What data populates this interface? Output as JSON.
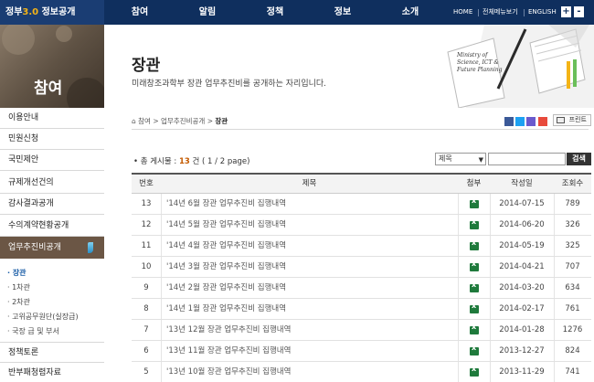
{
  "brand": {
    "prefix": "정부",
    "version": "3.0",
    "suffix": " 정보공개"
  },
  "nav": {
    "items": [
      "참여",
      "알림",
      "정책",
      "정보",
      "소개"
    ]
  },
  "util": {
    "home": "HOME",
    "sitemap": "전체메뉴보기",
    "english": "ENGLISH",
    "zoom_in": "+",
    "zoom_out": "-"
  },
  "sidebar": {
    "hero_title": "참여",
    "items": [
      "이용안내",
      "민원신청",
      "국민제안",
      "규제개선건의",
      "감사결과공개",
      "수의계약현황공개"
    ],
    "active": "업무추진비공개",
    "sub_items": [
      "· 장관",
      "· 1차관",
      "· 2차관",
      "· 고위공무원단(실장급)",
      "· 국장 급 및 부서"
    ],
    "after_items": [
      "정책토론",
      "반부패청렴자료"
    ]
  },
  "header": {
    "title": "장관",
    "desc": "미래창조과학부 장관 업무추진비를 공개하는 자리입니다.",
    "deco_text": "Ministry of Science, ICT & Future Planning"
  },
  "breadcrumb": {
    "home_icon": "home-icon",
    "part1": "참여",
    "part2": "업무추진비공개",
    "current": "장관"
  },
  "toolbar": {
    "print_label": "프린트"
  },
  "list": {
    "count_prefix": "• 총 게시물 : ",
    "count": "13",
    "count_suffix": " 건 ( 1 / 2 page)",
    "select_value": "제목",
    "search_button": "검색"
  },
  "table": {
    "headers": [
      "번호",
      "제목",
      "첨부",
      "작성일",
      "조회수"
    ],
    "rows": [
      {
        "no": "13",
        "title": "'14년 6월 장관 업무추진비 집행내역",
        "date": "2014-07-15",
        "views": "789"
      },
      {
        "no": "12",
        "title": "'14년 5월 장관 업무추진비 집행내역",
        "date": "2014-06-20",
        "views": "326"
      },
      {
        "no": "11",
        "title": "'14년 4월 장관 업무추진비 집행내역",
        "date": "2014-05-19",
        "views": "325"
      },
      {
        "no": "10",
        "title": "'14년 3월 장관 업무추진비 집행내역",
        "date": "2014-04-21",
        "views": "707"
      },
      {
        "no": "9",
        "title": "'14년 2월 장관 업무추진비 집행내역",
        "date": "2014-03-20",
        "views": "634"
      },
      {
        "no": "8",
        "title": "'14년 1월 장관 업무추진비 집행내역",
        "date": "2014-02-17",
        "views": "761"
      },
      {
        "no": "7",
        "title": "'13년 12월 장관 업무추진비 집행내역",
        "date": "2014-01-28",
        "views": "1276"
      },
      {
        "no": "6",
        "title": "'13년 11월 장관 업무추진비 집행내역",
        "date": "2013-12-27",
        "views": "824"
      },
      {
        "no": "5",
        "title": "'13년 10월 장관 업무추진비 집행내역",
        "date": "2013-11-29",
        "views": "741"
      }
    ]
  }
}
